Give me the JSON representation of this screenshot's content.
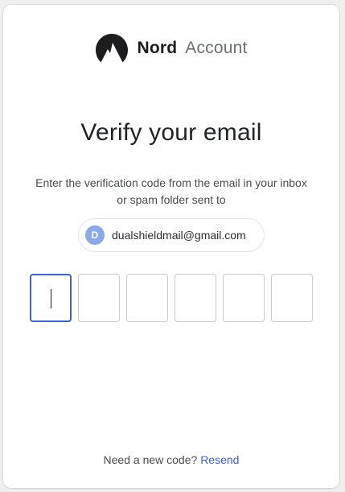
{
  "logo": {
    "brand_strong": "Nord",
    "brand_light": "Account",
    "icon": "nord-mountain-icon"
  },
  "title": "Verify your email",
  "subtitle": {
    "line1": "Enter the verification code from the email in your inbox",
    "line2": "or spam folder sent to"
  },
  "email_chip": {
    "avatar_initial": "D",
    "email": "dualshieldmail@gmail.com"
  },
  "code_inputs": [
    "",
    "",
    "",
    "",
    "",
    ""
  ],
  "resend": {
    "prompt": "Need a new code?",
    "link_label": "Resend"
  },
  "colors": {
    "accent": "#3e5fe0",
    "avatar_bg": "#8aa8ea",
    "text_primary": "#222428",
    "text_secondary": "#4a4d52"
  }
}
